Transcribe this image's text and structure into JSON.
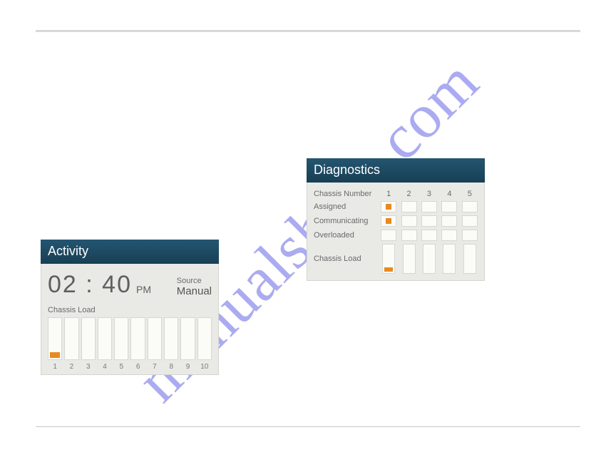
{
  "watermark": "manualshive.com",
  "activity": {
    "title": "Activity",
    "time": "02 : 40",
    "time_suffix": "PM",
    "source_label": "Source",
    "source_value": "Manual",
    "chassis_load_label": "Chassis Load",
    "bars": [
      {
        "num": "1",
        "fill": true
      },
      {
        "num": "2",
        "fill": false
      },
      {
        "num": "3",
        "fill": false
      },
      {
        "num": "4",
        "fill": false
      },
      {
        "num": "5",
        "fill": false
      },
      {
        "num": "6",
        "fill": false
      },
      {
        "num": "7",
        "fill": false
      },
      {
        "num": "8",
        "fill": false
      },
      {
        "num": "9",
        "fill": false
      },
      {
        "num": "10",
        "fill": false
      }
    ]
  },
  "diagnostics": {
    "title": "Diagnostics",
    "col_label": "Chassis Number",
    "columns": [
      "1",
      "2",
      "3",
      "4",
      "5"
    ],
    "rows": [
      {
        "label": "Assigned",
        "cells": [
          true,
          false,
          false,
          false,
          false
        ]
      },
      {
        "label": "Communicating",
        "cells": [
          true,
          false,
          false,
          false,
          false
        ]
      },
      {
        "label": "Overloaded",
        "cells": [
          false,
          false,
          false,
          false,
          false
        ]
      }
    ],
    "load_label": "Chassis Load",
    "load": [
      true,
      false,
      false,
      false,
      false
    ]
  }
}
